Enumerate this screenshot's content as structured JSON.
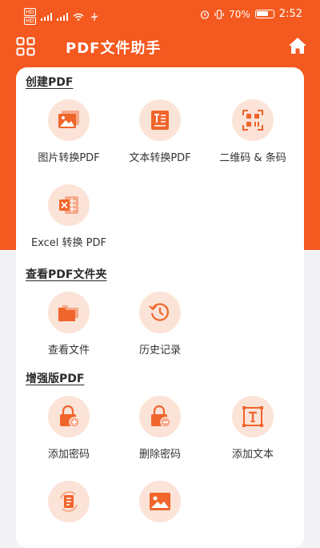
{
  "status_bar": {
    "battery": "70%",
    "time": "2:52",
    "network": "4G"
  },
  "header": {
    "title": "PDF文件助手"
  },
  "sections": [
    {
      "title": "创建PDF",
      "items": [
        {
          "label": "图片转换PDF",
          "icon": "image-icon"
        },
        {
          "label": "文本转换PDF",
          "icon": "text-doc-icon"
        },
        {
          "label": "二维码 & 条码",
          "icon": "qr-code-icon"
        },
        {
          "label": "Excel 转换 PDF",
          "icon": "excel-icon"
        }
      ]
    },
    {
      "title": "查看PDF文件夹",
      "items": [
        {
          "label": "查看文件",
          "icon": "folder-icon"
        },
        {
          "label": "历史记录",
          "icon": "history-icon"
        }
      ]
    },
    {
      "title": "增强版PDF",
      "items": [
        {
          "label": "添加密码",
          "icon": "lock-add-icon"
        },
        {
          "label": "删除密码",
          "icon": "lock-remove-icon"
        },
        {
          "label": "添加文本",
          "icon": "add-text-icon"
        },
        {
          "label": "",
          "icon": "rotate-doc-icon"
        },
        {
          "label": "",
          "icon": "image-icon"
        }
      ]
    }
  ],
  "colors": {
    "accent": "#f4591f",
    "icon_bg": "#fbe3d8",
    "icon": "#f0652b"
  }
}
